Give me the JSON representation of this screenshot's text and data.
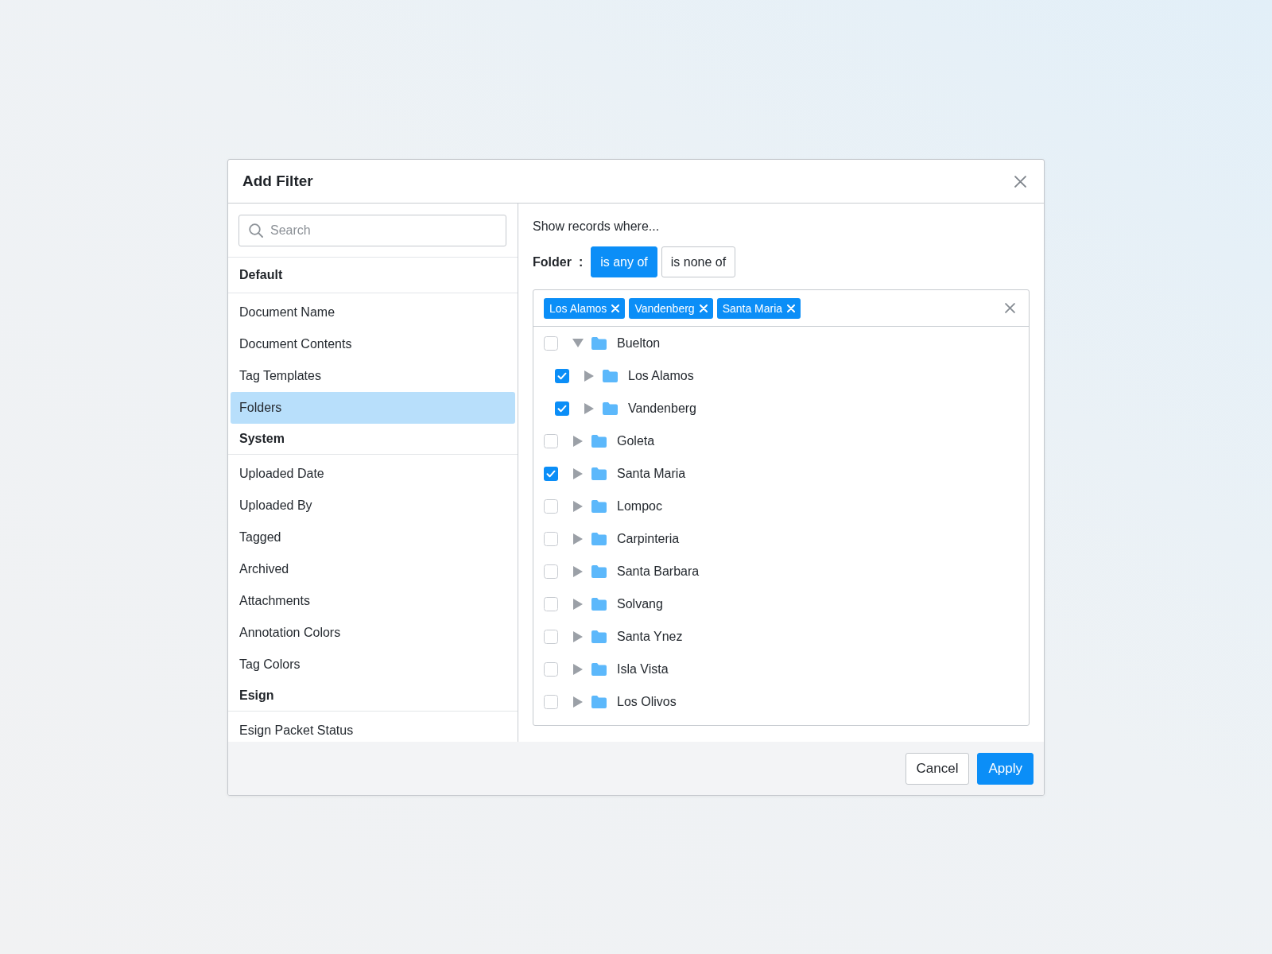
{
  "dialog": {
    "title": "Add Filter"
  },
  "search": {
    "placeholder": "Search"
  },
  "sidebar": {
    "groups": [
      {
        "heading": "Default",
        "items": [
          {
            "label": "Document Name",
            "selected": false
          },
          {
            "label": "Document Contents",
            "selected": false
          },
          {
            "label": "Tag Templates",
            "selected": false
          },
          {
            "label": "Folders",
            "selected": true
          }
        ]
      },
      {
        "heading": "System",
        "items": [
          {
            "label": "Uploaded Date",
            "selected": false
          },
          {
            "label": "Uploaded By",
            "selected": false
          },
          {
            "label": "Tagged",
            "selected": false
          },
          {
            "label": "Archived",
            "selected": false
          },
          {
            "label": "Attachments",
            "selected": false
          },
          {
            "label": "Annotation Colors",
            "selected": false
          },
          {
            "label": "Tag Colors",
            "selected": false
          }
        ]
      },
      {
        "heading": "Esign",
        "items": [
          {
            "label": "Esign Packet Status",
            "selected": false
          }
        ]
      }
    ]
  },
  "filter": {
    "prompt": "Show records where...",
    "field_label": "Folder",
    "separator": ":",
    "operators": [
      {
        "label": "is any of",
        "selected": true
      },
      {
        "label": "is none of",
        "selected": false
      }
    ],
    "tags": [
      "Los Alamos",
      "Vandenberg",
      "Santa Maria"
    ],
    "tree": [
      {
        "label": "Buelton",
        "checked": false,
        "expanded": true,
        "children": [
          {
            "label": "Los Alamos",
            "checked": true,
            "expanded": false
          },
          {
            "label": "Vandenberg",
            "checked": true,
            "expanded": false
          }
        ]
      },
      {
        "label": "Goleta",
        "checked": false,
        "expanded": false
      },
      {
        "label": "Santa Maria",
        "checked": true,
        "expanded": false
      },
      {
        "label": "Lompoc",
        "checked": false,
        "expanded": false
      },
      {
        "label": "Carpinteria",
        "checked": false,
        "expanded": false
      },
      {
        "label": "Santa Barbara",
        "checked": false,
        "expanded": false
      },
      {
        "label": "Solvang",
        "checked": false,
        "expanded": false
      },
      {
        "label": "Santa Ynez",
        "checked": false,
        "expanded": false
      },
      {
        "label": "Isla Vista",
        "checked": false,
        "expanded": false
      },
      {
        "label": "Los Olivos",
        "checked": false,
        "expanded": false
      }
    ]
  },
  "footer": {
    "buttons": [
      {
        "label": "Cancel",
        "kind": "secondary"
      },
      {
        "label": "Apply",
        "kind": "primary"
      }
    ]
  }
}
